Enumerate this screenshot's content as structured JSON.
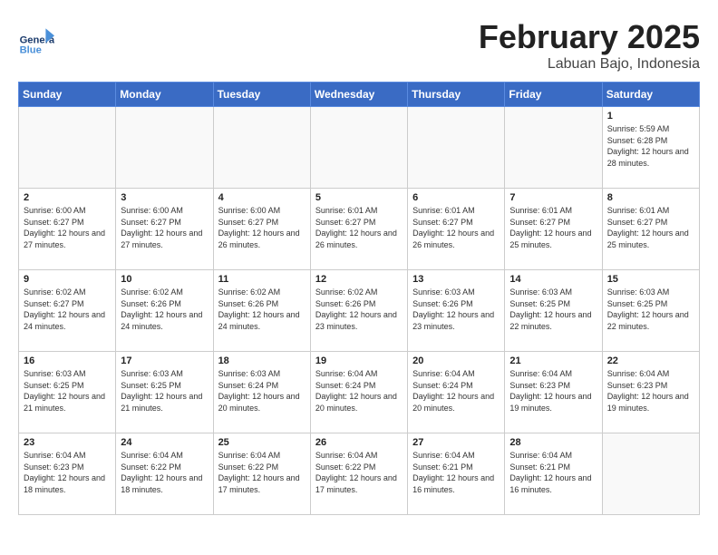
{
  "header": {
    "logo_general": "General",
    "logo_blue": "Blue",
    "month": "February 2025",
    "location": "Labuan Bajo, Indonesia"
  },
  "weekdays": [
    "Sunday",
    "Monday",
    "Tuesday",
    "Wednesday",
    "Thursday",
    "Friday",
    "Saturday"
  ],
  "weeks": [
    [
      {
        "day": "",
        "info": ""
      },
      {
        "day": "",
        "info": ""
      },
      {
        "day": "",
        "info": ""
      },
      {
        "day": "",
        "info": ""
      },
      {
        "day": "",
        "info": ""
      },
      {
        "day": "",
        "info": ""
      },
      {
        "day": "1",
        "info": "Sunrise: 5:59 AM\nSunset: 6:28 PM\nDaylight: 12 hours and 28 minutes."
      }
    ],
    [
      {
        "day": "2",
        "info": "Sunrise: 6:00 AM\nSunset: 6:27 PM\nDaylight: 12 hours and 27 minutes."
      },
      {
        "day": "3",
        "info": "Sunrise: 6:00 AM\nSunset: 6:27 PM\nDaylight: 12 hours and 27 minutes."
      },
      {
        "day": "4",
        "info": "Sunrise: 6:00 AM\nSunset: 6:27 PM\nDaylight: 12 hours and 26 minutes."
      },
      {
        "day": "5",
        "info": "Sunrise: 6:01 AM\nSunset: 6:27 PM\nDaylight: 12 hours and 26 minutes."
      },
      {
        "day": "6",
        "info": "Sunrise: 6:01 AM\nSunset: 6:27 PM\nDaylight: 12 hours and 26 minutes."
      },
      {
        "day": "7",
        "info": "Sunrise: 6:01 AM\nSunset: 6:27 PM\nDaylight: 12 hours and 25 minutes."
      },
      {
        "day": "8",
        "info": "Sunrise: 6:01 AM\nSunset: 6:27 PM\nDaylight: 12 hours and 25 minutes."
      }
    ],
    [
      {
        "day": "9",
        "info": "Sunrise: 6:02 AM\nSunset: 6:27 PM\nDaylight: 12 hours and 24 minutes."
      },
      {
        "day": "10",
        "info": "Sunrise: 6:02 AM\nSunset: 6:26 PM\nDaylight: 12 hours and 24 minutes."
      },
      {
        "day": "11",
        "info": "Sunrise: 6:02 AM\nSunset: 6:26 PM\nDaylight: 12 hours and 24 minutes."
      },
      {
        "day": "12",
        "info": "Sunrise: 6:02 AM\nSunset: 6:26 PM\nDaylight: 12 hours and 23 minutes."
      },
      {
        "day": "13",
        "info": "Sunrise: 6:03 AM\nSunset: 6:26 PM\nDaylight: 12 hours and 23 minutes."
      },
      {
        "day": "14",
        "info": "Sunrise: 6:03 AM\nSunset: 6:25 PM\nDaylight: 12 hours and 22 minutes."
      },
      {
        "day": "15",
        "info": "Sunrise: 6:03 AM\nSunset: 6:25 PM\nDaylight: 12 hours and 22 minutes."
      }
    ],
    [
      {
        "day": "16",
        "info": "Sunrise: 6:03 AM\nSunset: 6:25 PM\nDaylight: 12 hours and 21 minutes."
      },
      {
        "day": "17",
        "info": "Sunrise: 6:03 AM\nSunset: 6:25 PM\nDaylight: 12 hours and 21 minutes."
      },
      {
        "day": "18",
        "info": "Sunrise: 6:03 AM\nSunset: 6:24 PM\nDaylight: 12 hours and 20 minutes."
      },
      {
        "day": "19",
        "info": "Sunrise: 6:04 AM\nSunset: 6:24 PM\nDaylight: 12 hours and 20 minutes."
      },
      {
        "day": "20",
        "info": "Sunrise: 6:04 AM\nSunset: 6:24 PM\nDaylight: 12 hours and 20 minutes."
      },
      {
        "day": "21",
        "info": "Sunrise: 6:04 AM\nSunset: 6:23 PM\nDaylight: 12 hours and 19 minutes."
      },
      {
        "day": "22",
        "info": "Sunrise: 6:04 AM\nSunset: 6:23 PM\nDaylight: 12 hours and 19 minutes."
      }
    ],
    [
      {
        "day": "23",
        "info": "Sunrise: 6:04 AM\nSunset: 6:23 PM\nDaylight: 12 hours and 18 minutes."
      },
      {
        "day": "24",
        "info": "Sunrise: 6:04 AM\nSunset: 6:22 PM\nDaylight: 12 hours and 18 minutes."
      },
      {
        "day": "25",
        "info": "Sunrise: 6:04 AM\nSunset: 6:22 PM\nDaylight: 12 hours and 17 minutes."
      },
      {
        "day": "26",
        "info": "Sunrise: 6:04 AM\nSunset: 6:22 PM\nDaylight: 12 hours and 17 minutes."
      },
      {
        "day": "27",
        "info": "Sunrise: 6:04 AM\nSunset: 6:21 PM\nDaylight: 12 hours and 16 minutes."
      },
      {
        "day": "28",
        "info": "Sunrise: 6:04 AM\nSunset: 6:21 PM\nDaylight: 12 hours and 16 minutes."
      },
      {
        "day": "",
        "info": ""
      }
    ]
  ]
}
